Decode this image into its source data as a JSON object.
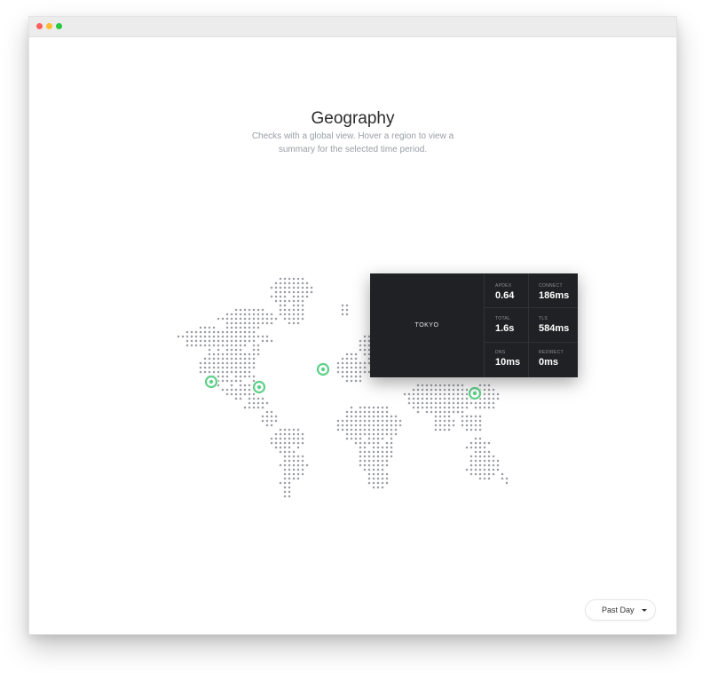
{
  "header": {
    "title": "Geography",
    "description": "Checks with a global view. Hover a region to view a summary for the selected time period."
  },
  "window_controls": {
    "close_color": "#ff5f57",
    "minimize_color": "#febc2e",
    "maximize_color": "#28c840"
  },
  "map": {
    "dot_color": "#9a9da3",
    "marker_color": "#5fd08a",
    "markers": [
      {
        "name": "us-west"
      },
      {
        "name": "us-east"
      },
      {
        "name": "europe"
      },
      {
        "name": "tokyo"
      }
    ]
  },
  "tooltip": {
    "city": "TOKYO",
    "background": "#1f2124",
    "metrics": [
      {
        "label": "APDEX",
        "value": "0.64"
      },
      {
        "label": "CONNECT",
        "value": "186ms"
      },
      {
        "label": "TOTAL",
        "value": "1.6s"
      },
      {
        "label": "TLS",
        "value": "584ms"
      },
      {
        "label": "DNS",
        "value": "10ms"
      },
      {
        "label": "REDIRECT",
        "value": "0ms"
      }
    ]
  },
  "time_range": {
    "selected": "Past Day"
  }
}
